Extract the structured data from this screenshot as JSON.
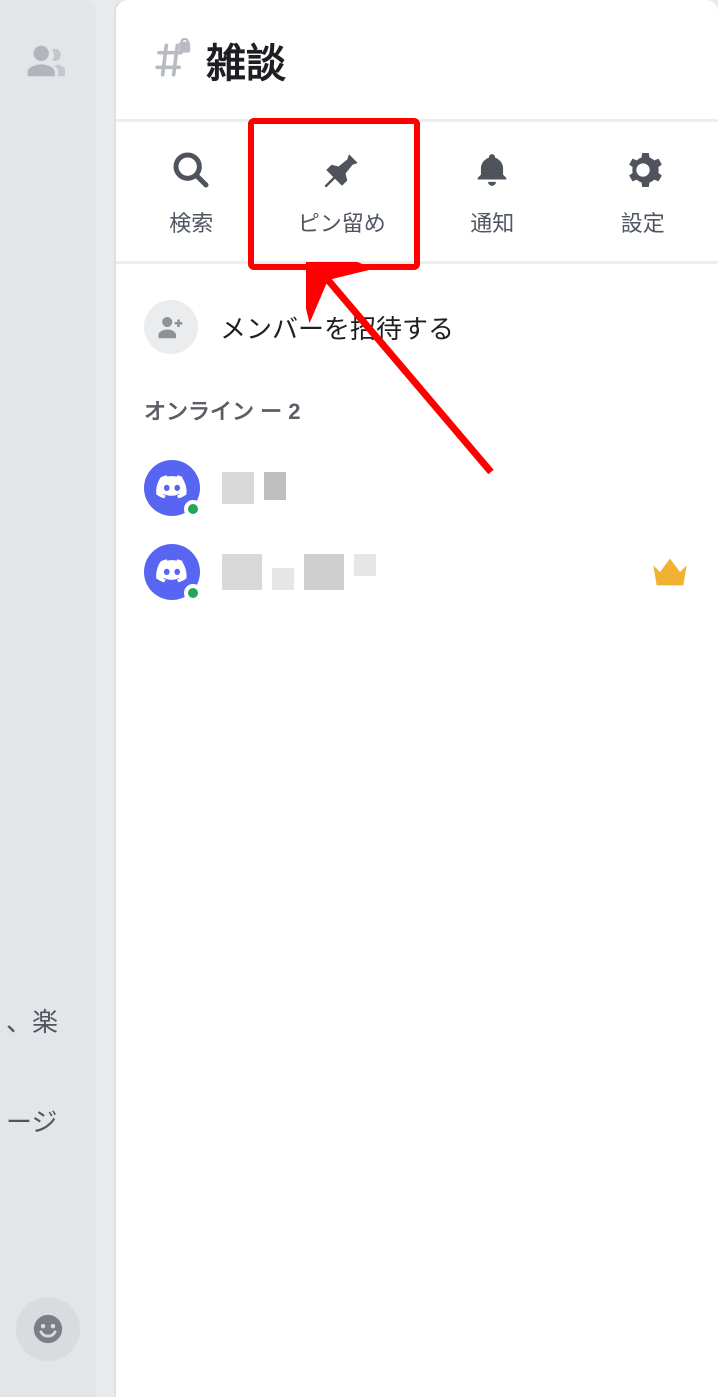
{
  "header": {
    "channel_name": "雑談"
  },
  "tabs": {
    "search": "検索",
    "pins": "ピン留め",
    "notifications": "通知",
    "settings": "設定"
  },
  "invite": {
    "label": "メンバーを招待する"
  },
  "members": {
    "section_title_prefix": "オンライン ー ",
    "online_count": "2"
  },
  "left_fragments": {
    "frag1": "、楽",
    "frag2": "ージ"
  }
}
